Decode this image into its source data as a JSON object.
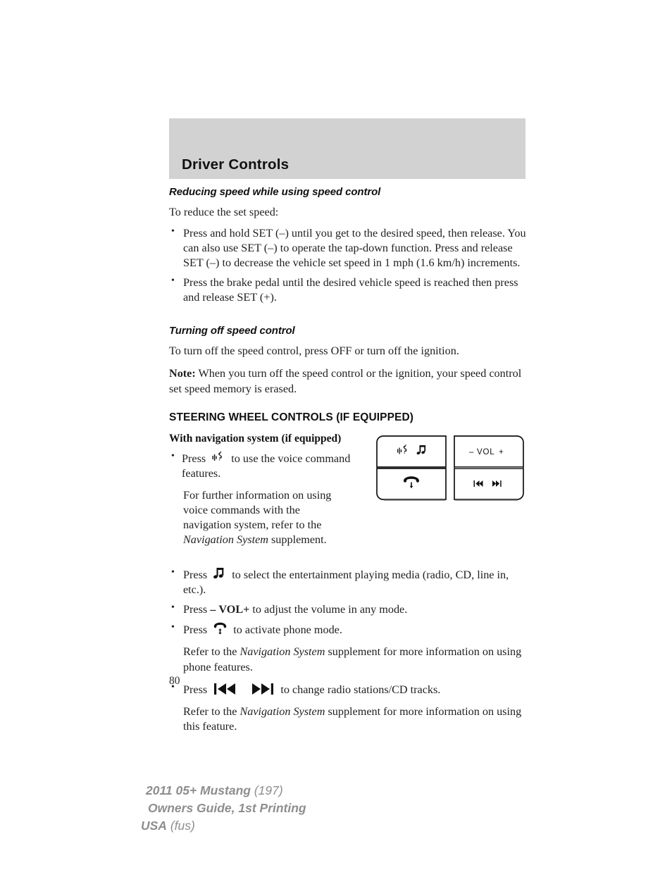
{
  "header": {
    "title": "Driver Controls"
  },
  "sections": {
    "reducing": {
      "heading": "Reducing speed while using speed control",
      "intro": "To reduce the set speed:",
      "bullets": [
        "Press and hold SET (–) until you get to the desired speed, then release. You can also use SET (–) to operate the tap-down function. Press and release SET (–) to decrease the vehicle set speed in 1 mph (1.6 km/h) increments.",
        "Press the brake pedal until the desired vehicle speed is reached then press and release SET (+)."
      ]
    },
    "turning_off": {
      "heading": "Turning off speed control",
      "para": "To turn off the speed control, press OFF or turn off the ignition.",
      "note_label": "Note:",
      "note_text": " When you turn off the speed control or the ignition, your speed control set speed memory is erased."
    },
    "steering": {
      "heading": "STEERING WHEEL CONTROLS (IF EQUIPPED)",
      "subheading": "With navigation system (if equipped)",
      "voice_bullet_pre": "Press",
      "voice_bullet_post": "to use the voice command features.",
      "voice_followup_pre": "For further information on using voice commands with the navigation system, refer to the ",
      "voice_followup_italic": "Navigation System",
      "voice_followup_post": " supplement.",
      "media_bullet_pre": "Press",
      "media_bullet_post": "to select the entertainment playing media (radio, CD, line in, etc.).",
      "vol_bullet_pre": "Press",
      "vol_bullet_minus": "–",
      "vol_bullet_label": "VOL",
      "vol_bullet_plus": "+",
      "vol_bullet_post": "to adjust the volume in any mode.",
      "phone_bullet_pre": "Press",
      "phone_bullet_post": "to activate phone mode.",
      "phone_followup_pre": "Refer to the ",
      "phone_followup_italic": "Navigation System",
      "phone_followup_post": " supplement for more information on using phone features.",
      "track_bullet_pre": "Press",
      "track_bullet_post": "to change radio stations/CD tracks.",
      "track_followup_pre": "Refer to the ",
      "track_followup_italic": "Navigation System",
      "track_followup_post": " supplement for more information on using this feature."
    }
  },
  "diagram": {
    "name": "steering-wheel-control-pad",
    "quadrants": {
      "top_left_icons": [
        "voice-command-icon",
        "music-note-icon"
      ],
      "bottom_left_icons": [
        "phone-hangup-icon"
      ],
      "top_right_label_minus": "–",
      "top_right_label_text": "VOL",
      "top_right_label_plus": "+",
      "bottom_right_icons": [
        "skip-previous-icon",
        "skip-next-icon"
      ]
    }
  },
  "page_number": "80",
  "footer": {
    "line1_bold": "2011 05+ Mustang",
    "line1_light": " (197)",
    "line2_bold": "Owners Guide, 1st Printing",
    "line3_bold": "USA",
    "line3_light": " (fus)"
  },
  "colors": {
    "header_band": "#d2d2d2",
    "text": "#1f1f1f",
    "footer": "#8e8e8e"
  }
}
